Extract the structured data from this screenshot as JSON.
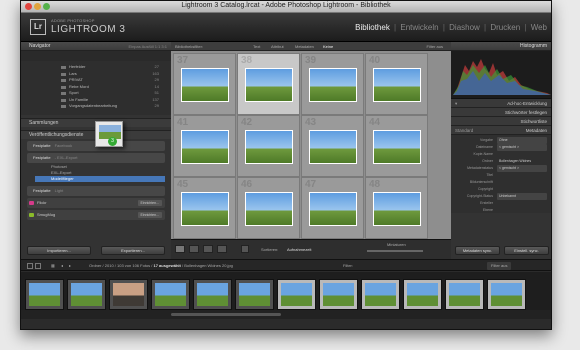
{
  "window": {
    "title": "Lightroom 3 Catalog.lrcat - Adobe Photoshop Lightroom - Bibliothek"
  },
  "identity": {
    "logo": "Lr",
    "adobe": "ADOBE PHOTOSHOP",
    "product": "LIGHTROOM 3"
  },
  "modules": [
    {
      "label": "Bibliothek",
      "active": true
    },
    {
      "label": "Entwickeln",
      "active": false
    },
    {
      "label": "Diashow",
      "active": false
    },
    {
      "label": "Drucken",
      "active": false
    },
    {
      "label": "Web",
      "active": false
    }
  ],
  "left": {
    "navigator": "Navigator",
    "nav_extra": "Einpas  Ausfüll  1:1  3:1",
    "folders": [
      {
        "name": "Herfelder",
        "count": "27"
      },
      {
        "name": "Lars",
        "count": "163"
      },
      {
        "name": "PRIVAT",
        "count": "29"
      },
      {
        "name": "Rebe Mord",
        "count": "14"
      },
      {
        "name": "Sport",
        "count": "51"
      },
      {
        "name": "Un Familie",
        "count": "137"
      },
      {
        "name": "Vorgangsdatenbearbeitung",
        "count": "29"
      }
    ],
    "sammlungen": "Sammlungen",
    "veroeffentlichung": "Veröffentlichungsdienste",
    "pub1": {
      "name": "Festplatte",
      "sub": "Facebook"
    },
    "pub2": {
      "name": "Festplatte",
      "sub": "- EXL-Export"
    },
    "sublist": [
      "Photoset",
      "EXL-Export",
      "Modellflieger"
    ],
    "pub3": {
      "name": "Festplatte",
      "sub": "Light"
    },
    "services": [
      {
        "name": "Flickr",
        "btn": "Einrichten...",
        "color": "#d53a8a"
      },
      {
        "name": "SmugMug",
        "btn": "Einrichten...",
        "color": "#8bbb2a"
      }
    ],
    "btn_import": "Importieren...",
    "btn_export": "Exportieren...",
    "drag_badge": "3"
  },
  "center": {
    "filter": {
      "label": "Bibliotheksfilter:",
      "opts": [
        "Text",
        "Attribut",
        "Metadaten",
        "Keine"
      ],
      "preset": "Filter aus"
    },
    "cells": [
      {
        "num": "37"
      },
      {
        "num": "38"
      },
      {
        "num": "39"
      },
      {
        "num": "40"
      },
      {
        "num": "41"
      },
      {
        "num": "42"
      },
      {
        "num": "43"
      },
      {
        "num": "44"
      },
      {
        "num": "45"
      },
      {
        "num": "46"
      },
      {
        "num": "47"
      },
      {
        "num": "48"
      }
    ],
    "sort_label": "Sortieren:",
    "sort_value": "Aufnahmezeit",
    "thumbs_label": "Miniaturen"
  },
  "right": {
    "histogram": "Histogramm",
    "quick_dev": "Ad-hoc-Entwicklung",
    "keyword_tags": "Stichwörter festlegen",
    "keyword_list": "Stichwortliste",
    "metadata": "Metadaten",
    "standard": "Standard",
    "preset_label": "Vorgabe",
    "preset_value": "Ohne",
    "meta_rows": [
      {
        "k": "Dateiname",
        "v": "< gemischt >"
      },
      {
        "k": "Kopie-Name",
        "v": ""
      },
      {
        "k": "Ordner",
        "v": "Bollenhagen Widnes"
      },
      {
        "k": "Metadatenstatus",
        "v": "< gemischt >"
      },
      {
        "k": "Titel",
        "v": ""
      },
      {
        "k": "Bildunterschrift",
        "v": ""
      },
      {
        "k": "Copyright",
        "v": ""
      },
      {
        "k": "Copyright-Status",
        "v": "Unbekannt"
      },
      {
        "k": "Ersteller",
        "v": ""
      },
      {
        "k": "Ebene",
        "v": ""
      }
    ],
    "btn_sync_meta": "Metadaten sync.",
    "btn_sync_settings": "Einstell. sync."
  },
  "filmstrip": {
    "path": "Ordner / 2010 / 103 von 106 Fotos /",
    "selected": "17 ausgewählt",
    "file": "/ Bollenhagen Widnes 20.jpg",
    "filter_label": "Filter:",
    "filter_value": "Filter aus"
  }
}
